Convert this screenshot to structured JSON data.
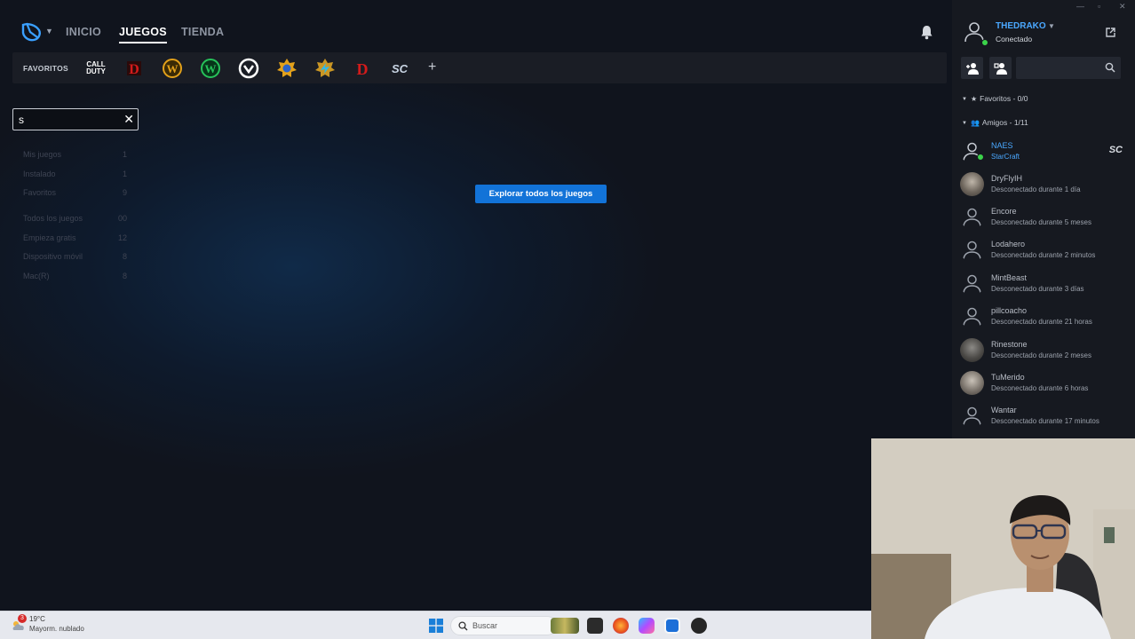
{
  "nav": {
    "items": [
      "INICIO",
      "JUEGOS",
      "TIENDA"
    ],
    "active": "JUEGOS"
  },
  "favorites": {
    "label": "FAVORITOS",
    "games": [
      {
        "name": "call-of-duty",
        "text": "CALL\nDUTY",
        "color": "#ffffff"
      },
      {
        "name": "diablo-iv",
        "text": "D",
        "color": "#d31b1b"
      },
      {
        "name": "world-of-warcraft",
        "text": "W",
        "color": "#e3a11a"
      },
      {
        "name": "wow-classic",
        "text": "W",
        "color": "#27c25a"
      },
      {
        "name": "overwatch",
        "text": "",
        "color": "#ffffff"
      },
      {
        "name": "hearthstone",
        "text": "",
        "color": "#e3a11a"
      },
      {
        "name": "heroes-of-the-storm",
        "text": "",
        "color": "#2fb9e8"
      },
      {
        "name": "diablo-iii",
        "text": "D",
        "color": "#d31b1b"
      },
      {
        "name": "starcraft",
        "text": "SC",
        "color": "#c9d5e4"
      }
    ],
    "add": "+"
  },
  "filters": {
    "search_value": "s",
    "items": [
      {
        "label": "Mis juegos",
        "count": "1"
      },
      {
        "label": "Instalado",
        "count": "1"
      },
      {
        "label": "Favoritos",
        "count": "9"
      },
      {
        "label": "Todos los juegos",
        "count": "00"
      },
      {
        "label": "Empieza gratis",
        "count": "12"
      },
      {
        "label": "Dispositivo móvil",
        "count": "8"
      },
      {
        "label": "Mac(R)",
        "count": "8"
      }
    ]
  },
  "main": {
    "explore_button": "Explorar todos los juegos"
  },
  "user": {
    "name": "THEDRAKO",
    "status": "Conectado"
  },
  "friends_panel": {
    "favorites_section": "Favoritos - 0/0",
    "friends_section": "Amigos - 1/11",
    "friends": [
      {
        "name": "NAES",
        "status": "StarCraft",
        "online": true,
        "game": "SC"
      },
      {
        "name": "DryFlyIH",
        "status": "Desconectado durante 1 día",
        "online": false
      },
      {
        "name": "Encore",
        "status": "Desconectado durante 5 meses",
        "online": false
      },
      {
        "name": "Lodahero",
        "status": "Desconectado durante 2 minutos",
        "online": false
      },
      {
        "name": "MintBeast",
        "status": "Desconectado durante 3 días",
        "online": false
      },
      {
        "name": "pillcoacho",
        "status": "Desconectado durante 21 horas",
        "online": false
      },
      {
        "name": "Rinestone",
        "status": "Desconectado durante 2 meses",
        "online": false
      },
      {
        "name": "TuMerido",
        "status": "Desconectado durante 6 horas",
        "online": false
      },
      {
        "name": "Wantar",
        "status": "Desconectado durante 17 minutos",
        "online": false
      }
    ]
  },
  "taskbar": {
    "weather_temp": "19°C",
    "weather_desc": "Mayorm. nublado",
    "weather_badge": "3",
    "search_label": "Buscar"
  },
  "colors": {
    "accent": "#1273d8",
    "online": "#3bd34a",
    "link": "#4aa8ff"
  }
}
